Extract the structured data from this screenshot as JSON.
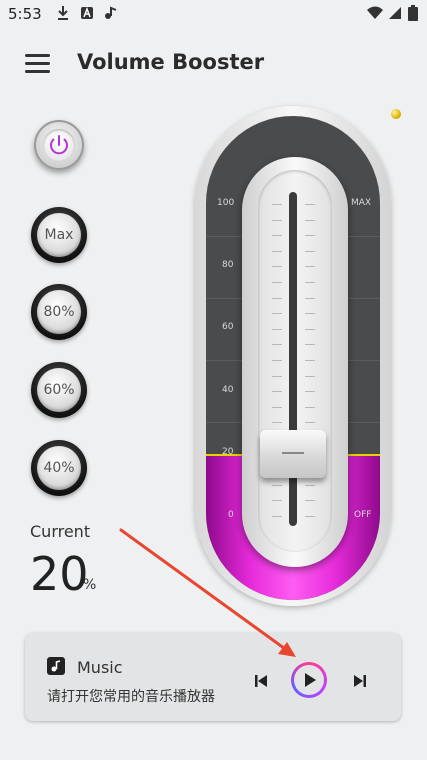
{
  "status_bar": {
    "time": "5:53"
  },
  "header": {
    "title": "Volume Booster"
  },
  "boost_buttons": [
    {
      "label": "Max"
    },
    {
      "label": "80%"
    },
    {
      "label": "60%"
    },
    {
      "label": "40%"
    }
  ],
  "meter": {
    "left_ticks": [
      "100",
      "80",
      "60",
      "40",
      "20",
      "0"
    ],
    "right_top": "MAX",
    "right_bottom": "OFF",
    "level_percent": 20
  },
  "current": {
    "label": "Current",
    "value": "20",
    "unit": "%"
  },
  "music": {
    "title": "Music",
    "subtitle": "请打开您常用的音乐播放器"
  },
  "colors": {
    "accent": "#e52ad9",
    "level_line": "#e8d100",
    "annotation_arrow": "#e8462f"
  }
}
